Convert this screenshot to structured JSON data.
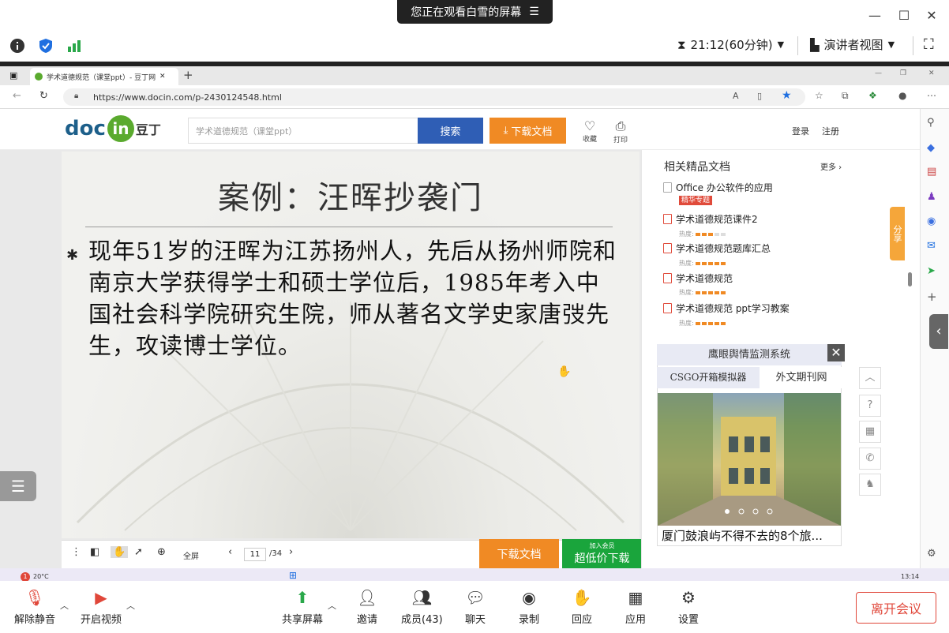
{
  "meeting": {
    "share_banner": "您正在观看白雪的屏幕",
    "timer": "21:12(60分钟)",
    "view_mode": "演讲者视图",
    "bottom": {
      "mute": "解除静音",
      "video": "开启视频",
      "share": "共享屏幕",
      "invite": "邀请",
      "members": "成员(43)",
      "chat": "聊天",
      "record": "录制",
      "react": "回应",
      "apps": "应用",
      "settings": "设置",
      "leave": "离开会议"
    }
  },
  "browser": {
    "tab_title": "学术道德规范（课堂ppt）- 豆丁网",
    "url": "https://www.docin.com/p-2430124548.html"
  },
  "site": {
    "logo_doc": "doc",
    "logo_in": "in",
    "logo_cn": "豆丁",
    "search_placeholder": "学术道德规范（课堂ppt）",
    "search_btn": "搜索",
    "download_btn": "下载文档",
    "collect": "收藏",
    "print": "打印",
    "login": "登录",
    "register": "注册"
  },
  "slide": {
    "title": "案例：汪晖抄袭门",
    "body": "现年51岁的汪晖为江苏扬州人，先后从扬州师院和南京大学获得学士和硕士学位后，1985年考入中国社会科学院研究生院，师从著名文学史家唐弢先生，攻读博士学位。"
  },
  "viewer": {
    "fullscreen": "全屏",
    "page_current": "11",
    "page_total": "/34",
    "download": "下载文档",
    "vip_small": "加入会员",
    "vip_big": "超低价下载"
  },
  "related": {
    "title": "相关精品文档",
    "more": "更多",
    "heat_label": "热度:",
    "items": [
      {
        "title": "Office 办公软件的应用",
        "badge": "精华专题"
      },
      {
        "title": "学术道德规范课件2",
        "heat": 3
      },
      {
        "title": "学术道德规范题库汇总",
        "heat": 5
      },
      {
        "title": "学术道德规范",
        "heat": 5
      },
      {
        "title": "学术道德规范 ppt学习教案",
        "heat": 5
      }
    ]
  },
  "ad": {
    "title": "鹰眼舆情监测系统",
    "tab1": "CSGO开箱模拟器",
    "tab2": "外文期刊网",
    "caption": "厦门鼓浪屿不得不去的8个旅..."
  },
  "share_side": "分享",
  "taskbar": {
    "weather": "20°C",
    "time": "13:14"
  }
}
